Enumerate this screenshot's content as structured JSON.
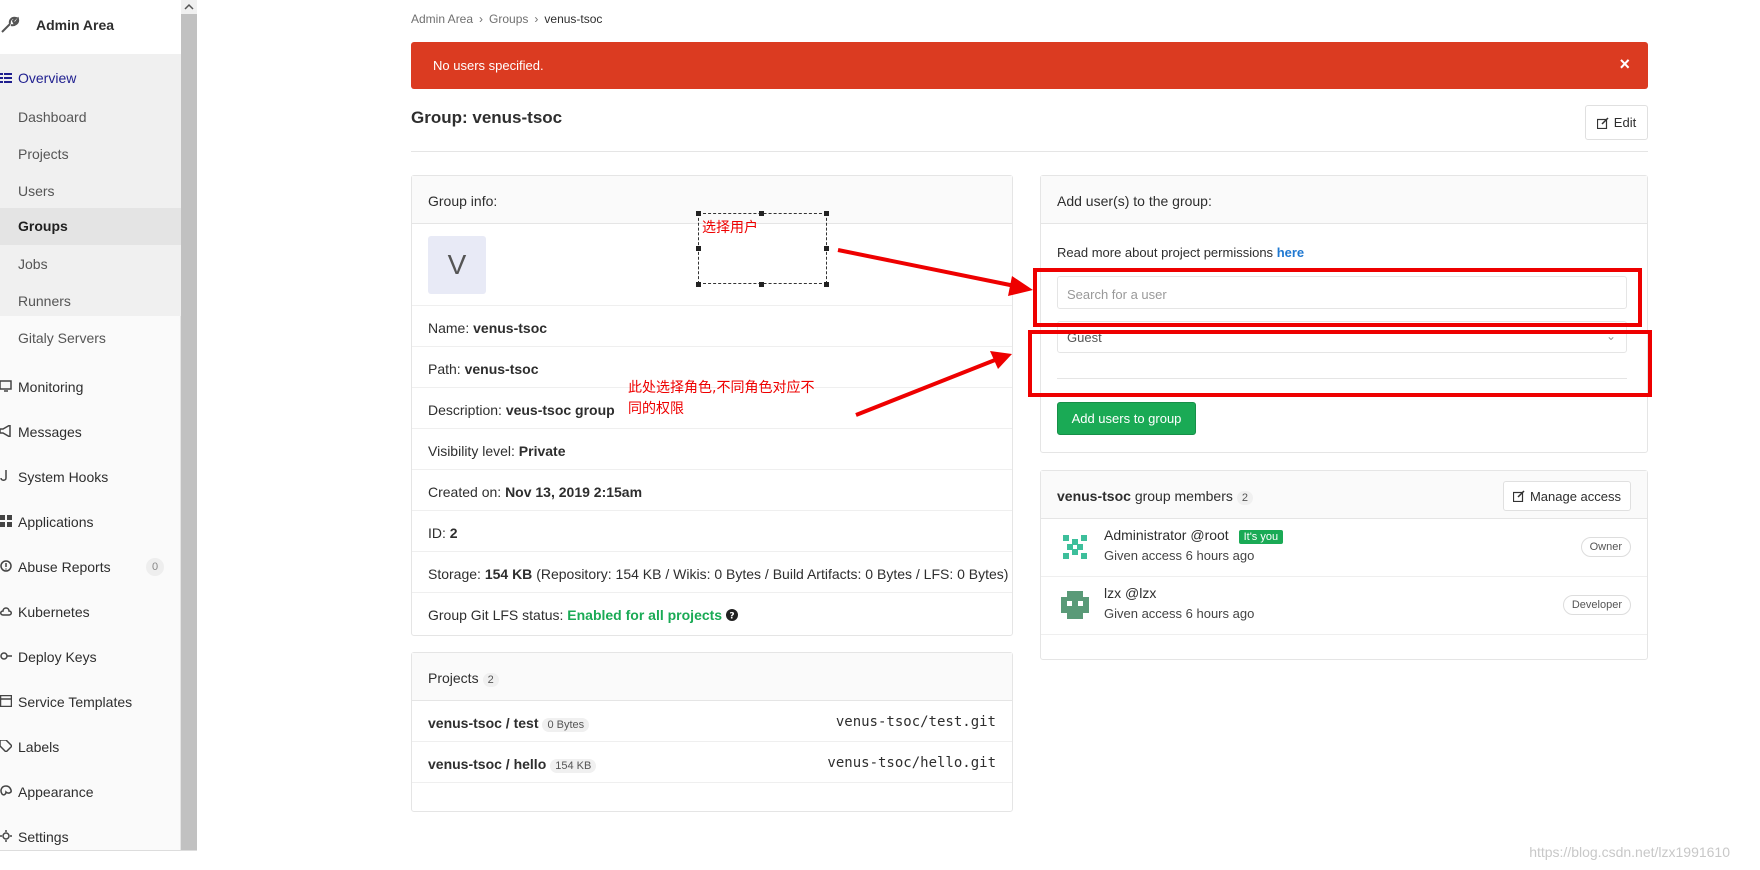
{
  "sidebar": {
    "title": "Admin Area",
    "overview_label": "Overview",
    "overview_items": [
      {
        "label": "Dashboard"
      },
      {
        "label": "Projects"
      },
      {
        "label": "Users"
      },
      {
        "label": "Groups"
      },
      {
        "label": "Jobs"
      },
      {
        "label": "Runners"
      },
      {
        "label": "Gitaly Servers"
      }
    ],
    "items": [
      {
        "label": "Monitoring"
      },
      {
        "label": "Messages"
      },
      {
        "label": "System Hooks"
      },
      {
        "label": "Applications"
      },
      {
        "label": "Abuse Reports",
        "count": "0"
      },
      {
        "label": "Kubernetes"
      },
      {
        "label": "Deploy Keys"
      },
      {
        "label": "Service Templates"
      },
      {
        "label": "Labels"
      },
      {
        "label": "Appearance"
      },
      {
        "label": "Settings"
      }
    ]
  },
  "breadcrumb": [
    "Admin Area",
    "Groups",
    "venus-tsoc"
  ],
  "alert": {
    "message": "No users specified.",
    "close": "×"
  },
  "page": {
    "title": "Group: venus-tsoc",
    "edit_label": "Edit"
  },
  "group_info": {
    "header": "Group info:",
    "avatar_letter": "V",
    "name_label": "Name:",
    "name_value": "venus-tsoc",
    "path_label": "Path:",
    "path_value": "venus-tsoc",
    "desc_label": "Description:",
    "desc_value": "veus-tsoc group",
    "vis_label": "Visibility level:",
    "vis_value": "Private",
    "created_label": "Created on:",
    "created_value": "Nov 13, 2019 2:15am",
    "id_label": "ID:",
    "id_value": "2",
    "storage_label": "Storage:",
    "storage_value": "154 KB",
    "storage_detail": "(Repository: 154 KB / Wikis: 0 Bytes / Build Artifacts: 0 Bytes / LFS: 0 Bytes)",
    "lfs_label": "Group Git LFS status:",
    "lfs_value": "Enabled for all projects"
  },
  "projects": {
    "header": "Projects",
    "count": "2",
    "items": [
      {
        "name": "venus-tsoc / test",
        "size": "0 Bytes",
        "git": "venus-tsoc/test.git"
      },
      {
        "name": "venus-tsoc / hello",
        "size": "154 KB",
        "git": "venus-tsoc/hello.git"
      }
    ]
  },
  "add_users": {
    "header": "Add user(s) to the group:",
    "perm_text": "Read more about project permissions",
    "perm_link": "here",
    "search_placeholder": "Search for a user",
    "role_value": "Guest",
    "button_label": "Add users to group"
  },
  "members": {
    "group_name": "venus-tsoc",
    "header_suffix": "group members",
    "count": "2",
    "manage_label": "Manage access",
    "items": [
      {
        "name": "Administrator",
        "handle": "@root",
        "badge": "It's you",
        "access": "Given access 6 hours ago",
        "role": "Owner"
      },
      {
        "name": "lzx",
        "handle": "@lzx",
        "badge": "",
        "access": "Given access 6 hours ago",
        "role": "Developer"
      }
    ]
  },
  "annotations": {
    "select_user": "选择用户",
    "select_role_line1": "此处选择角色,不同角色对应不",
    "select_role_line2": "同的权限"
  },
  "watermark": "https://blog.csdn.net/lzx1991610",
  "colors": {
    "alert": "#db3b21",
    "primary_green": "#1aaa55",
    "annotation_red": "#ee0000",
    "link_blue": "#1f78d1"
  }
}
